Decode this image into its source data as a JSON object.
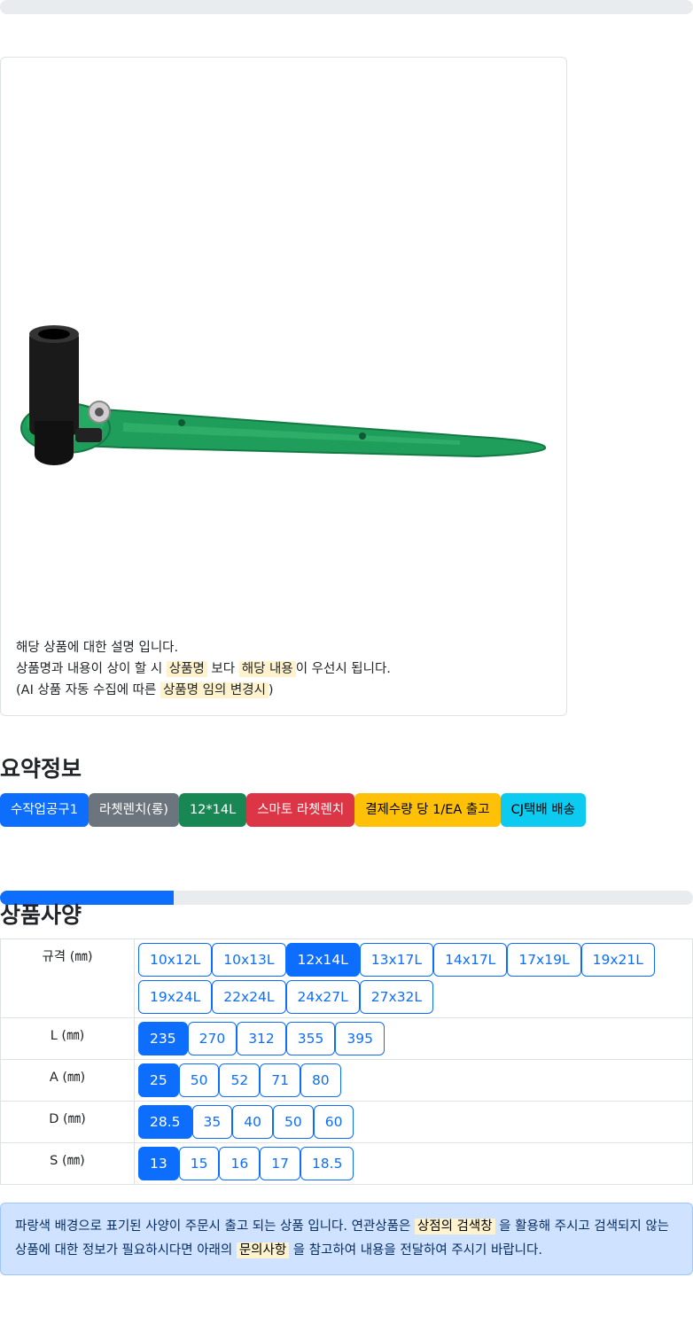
{
  "product": {
    "image_icon": "ratchet-wrench-image",
    "description": {
      "line1": "해당 상품에 대한 설명 입니다.",
      "line2_a": "상품명과 내용이 상이 할 시 ",
      "line2_hl1": "상품명",
      "line2_b": " 보다 ",
      "line2_hl2": "해당 내용",
      "line2_c": "이 우선시 됩니다.",
      "line3_a": "(AI 상품 자동 수집에 따른 ",
      "line3_hl": "상품명 임의 변경시",
      "line3_b": ")"
    }
  },
  "summary": {
    "title": "요약정보",
    "badges": [
      "수작업공구1",
      "라쳇렌치(롱)",
      "12*14L",
      "스마토 라쳇렌치",
      "결제수량 당 1/EA 출고",
      "CJ택배 배송"
    ]
  },
  "progress": {
    "fraction": 0.25
  },
  "spec": {
    "title": "상품사양",
    "rows": [
      {
        "label": "규격 (㎜)",
        "options": [
          "10x12L",
          "10x13L",
          "12x14L",
          "13x17L",
          "14x17L",
          "17x19L",
          "19x21L",
          "19x24L",
          "22x24L",
          "24x27L",
          "27x32L"
        ],
        "selected": "12x14L"
      },
      {
        "label": "L (㎜)",
        "options": [
          "235",
          "270",
          "312",
          "355",
          "395"
        ],
        "selected": "235"
      },
      {
        "label": "A (㎜)",
        "options": [
          "25",
          "50",
          "52",
          "71",
          "80"
        ],
        "selected": "25"
      },
      {
        "label": "D (㎜)",
        "options": [
          "28.5",
          "35",
          "40",
          "50",
          "60"
        ],
        "selected": "28.5"
      },
      {
        "label": "S (㎜)",
        "options": [
          "13",
          "15",
          "16",
          "17",
          "18.5"
        ],
        "selected": "13"
      }
    ]
  },
  "notice": {
    "a": "파랑색 배경으로 표기된 사양이 주문시 출고 되는 상품 입니다. 연관상품은 ",
    "hl1": "상점의 검색창",
    "b": " 을 활용해 주시고 검색되지 않는 상품에 대한 정보가 필요하시다면 아래의 ",
    "hl2": "문의사항",
    "c": " 을 참고하여 내용을 전달하여 주시기 바랍니다."
  },
  "colors": {
    "primary": "#0d6efd",
    "secondary": "#6c757d",
    "success": "#198754",
    "danger": "#dc3545",
    "warning": "#ffc107",
    "info": "#0dcaf0",
    "wrench_green": "#1e9e5a",
    "socket_black": "#1a1a1a"
  }
}
